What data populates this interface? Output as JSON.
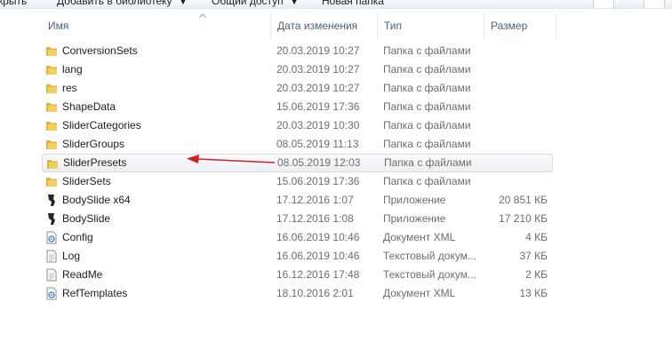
{
  "toolbar": {
    "items": [
      "крыть",
      "Добавить в библиотеку",
      "Общий доступ",
      "Новая папка"
    ]
  },
  "columns": {
    "name": "Имя",
    "date": "Дата изменения",
    "type": "Тип",
    "size": "Размер"
  },
  "files": [
    {
      "name": "ConversionSets",
      "date": "20.03.2019 10:27",
      "type": "Папка с файлами",
      "size": "",
      "icon": "folder-icon"
    },
    {
      "name": "lang",
      "date": "20.03.2019 10:27",
      "type": "Папка с файлами",
      "size": "",
      "icon": "folder-icon"
    },
    {
      "name": "res",
      "date": "20.03.2019 10:27",
      "type": "Папка с файлами",
      "size": "",
      "icon": "folder-icon"
    },
    {
      "name": "ShapeData",
      "date": "15.06.2019 17:36",
      "type": "Папка с файлами",
      "size": "",
      "icon": "folder-icon"
    },
    {
      "name": "SliderCategories",
      "date": "20.03.2019 10:30",
      "type": "Папка с файлами",
      "size": "",
      "icon": "folder-icon"
    },
    {
      "name": "SliderGroups",
      "date": "08.05.2019 11:13",
      "type": "Папка с файлами",
      "size": "",
      "icon": "folder-icon"
    },
    {
      "name": "SliderPresets",
      "date": "08.05.2019 12:03",
      "type": "Папка с файлами",
      "size": "",
      "icon": "folder-icon"
    },
    {
      "name": "SliderSets",
      "date": "15.06.2019 17:36",
      "type": "Папка с файлами",
      "size": "",
      "icon": "folder-icon"
    },
    {
      "name": "BodySlide x64",
      "date": "17.12.2016 1:07",
      "type": "Приложение",
      "size": "20 851 КБ",
      "icon": "app-icon"
    },
    {
      "name": "BodySlide",
      "date": "17.12.2016 1:08",
      "type": "Приложение",
      "size": "17 210 КБ",
      "icon": "app-icon"
    },
    {
      "name": "Config",
      "date": "16.06.2019 10:46",
      "type": "Документ XML",
      "size": "4 КБ",
      "icon": "xml-file-icon"
    },
    {
      "name": "Log",
      "date": "16.06.2019 10:46",
      "type": "Текстовый докум...",
      "size": "37 КБ",
      "icon": "text-file-icon"
    },
    {
      "name": "ReadMe",
      "date": "16.12.2016 17:48",
      "type": "Текстовый докум...",
      "size": "2 КБ",
      "icon": "text-file-icon"
    },
    {
      "name": "RefTemplates",
      "date": "18.10.2016 2:01",
      "type": "Документ XML",
      "size": "13 КБ",
      "icon": "xml-file-icon"
    }
  ],
  "selected_index": 6,
  "colors": {
    "folder": "#e8c04e",
    "header_text": "#4c607a",
    "secondary_text": "#6d6d6d",
    "annotation_arrow": "#d42020"
  }
}
